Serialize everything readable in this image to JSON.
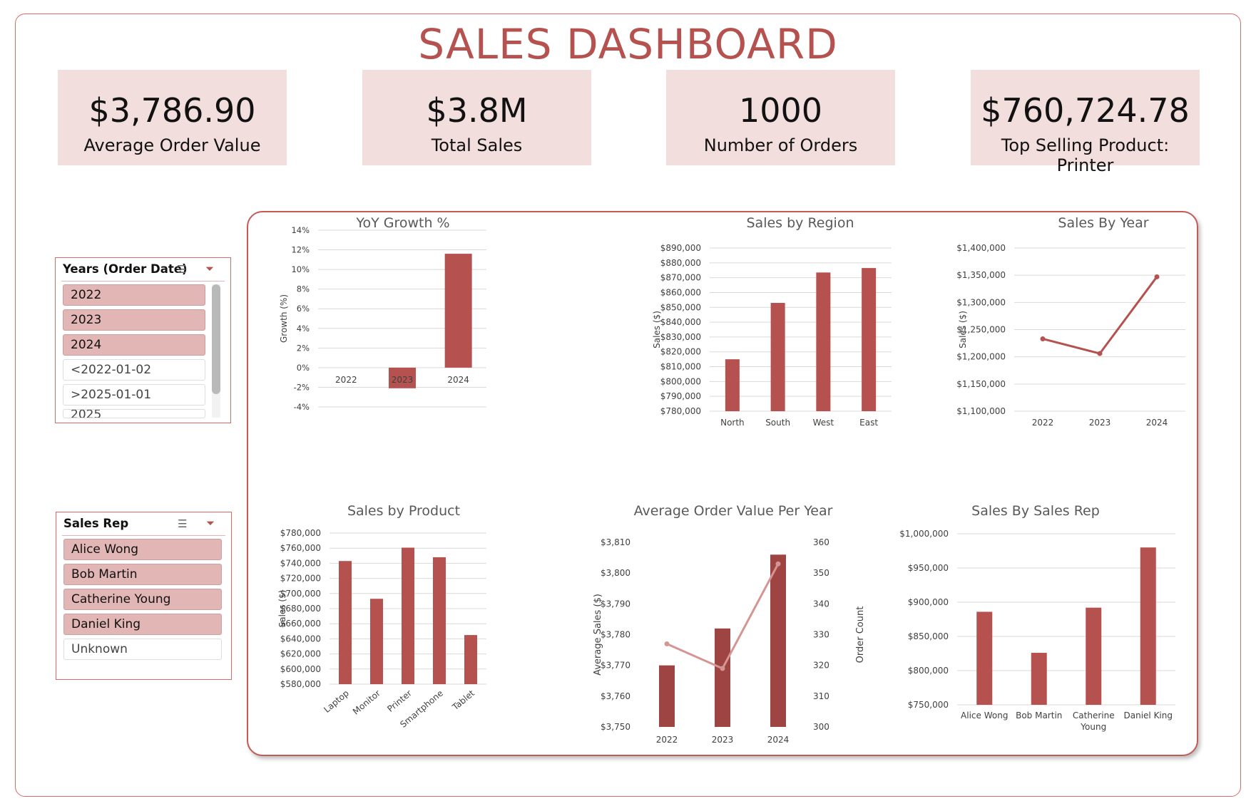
{
  "title": "SALES DASHBOARD",
  "kpis": [
    {
      "value": "$3,786.90",
      "label": "Average Order Value"
    },
    {
      "value": "$3.8M",
      "label": "Total Sales"
    },
    {
      "value": "1000",
      "label": "Number of Orders"
    },
    {
      "value": "$760,724.78",
      "label": "Top Selling Product: Printer"
    }
  ],
  "slicers": {
    "years": {
      "header": "Years (Order Date)",
      "items": [
        "2022",
        "2023",
        "2024",
        "<2022-01-02",
        ">2025-01-01",
        "2025"
      ],
      "selected": [
        true,
        true,
        true,
        false,
        false,
        false
      ]
    },
    "reps": {
      "header": "Sales Rep",
      "items": [
        "Alice Wong",
        "Bob Martin",
        "Catherine Young",
        "Daniel King",
        "Unknown"
      ],
      "selected": [
        true,
        true,
        true,
        true,
        false
      ]
    }
  },
  "icons": [
    "multi-select-icon",
    "clear-filter-icon"
  ],
  "colors": {
    "bar": "#b5524f",
    "bar_dark": "#9e4442",
    "line2": "#d59593",
    "accent": "#b5524f",
    "kpi_bg": "#f1dedd"
  },
  "chart_data": [
    {
      "type": "bar",
      "title": "YoY Growth %",
      "ylabel": "Growth (%)",
      "categories": [
        "2022",
        "2023",
        "2024"
      ],
      "values": [
        0,
        -2.1,
        11.6
      ],
      "ylim": [
        -4,
        14
      ],
      "yticks": [
        "14%",
        "12%",
        "10%",
        "8%",
        "6%",
        "4%",
        "2%",
        "0%",
        "-2%",
        "-4%"
      ]
    },
    {
      "type": "bar",
      "title": "Sales by Region",
      "ylabel": "Sales ($)",
      "categories": [
        "North",
        "South",
        "West",
        "East"
      ],
      "values": [
        815000,
        853000,
        873500,
        876500
      ],
      "ylim": [
        780000,
        890000
      ],
      "yticks": [
        "$890,000",
        "$880,000",
        "$870,000",
        "$860,000",
        "$850,000",
        "$840,000",
        "$830,000",
        "$820,000",
        "$810,000",
        "$800,000",
        "$790,000",
        "$780,000"
      ]
    },
    {
      "type": "line",
      "title": "Sales By Year",
      "ylabel": "Sales ($)",
      "categories": [
        "2022",
        "2023",
        "2024"
      ],
      "values": [
        1233000,
        1206000,
        1347000
      ],
      "ylim": [
        1100000,
        1400000
      ],
      "yticks": [
        "$1,400,000",
        "$1,350,000",
        "$1,300,000",
        "$1,250,000",
        "$1,200,000",
        "$1,150,000",
        "$1,100,000"
      ]
    },
    {
      "type": "bar",
      "title": "Sales by Product",
      "ylabel": "Sales ($)",
      "categories": [
        "Laptop",
        "Monitor",
        "Printer",
        "Smartphone",
        "Tablet"
      ],
      "values": [
        743000,
        693000,
        760700,
        748000,
        645000
      ],
      "ylim": [
        580000,
        780000
      ],
      "yticks": [
        "$780,000",
        "$760,000",
        "$740,000",
        "$720,000",
        "$700,000",
        "$680,000",
        "$660,000",
        "$640,000",
        "$620,000",
        "$600,000",
        "$580,000"
      ]
    },
    {
      "type": "bar",
      "title": "Average Order Value Per Year",
      "ylabel": "Average Sales ($)",
      "y2label": "Order Count",
      "categories": [
        "2022",
        "2023",
        "2024"
      ],
      "series": [
        {
          "values": [
            3770,
            3782,
            3806
          ]
        },
        {
          "values": [
            327,
            319,
            353
          ]
        }
      ],
      "ylim": [
        3750,
        3810
      ],
      "y2lim": [
        300,
        360
      ],
      "yticks": [
        "$3,810",
        "$3,800",
        "$3,790",
        "$3,780",
        "$3,770",
        "$3,760",
        "$3,750"
      ],
      "y2ticks": [
        "360",
        "350",
        "340",
        "330",
        "320",
        "310",
        "300"
      ]
    },
    {
      "type": "bar",
      "title": "Sales By Sales Rep",
      "categories": [
        "Alice Wong",
        "Bob Martin",
        "Catherine Young",
        "Daniel King"
      ],
      "values": [
        886000,
        826000,
        892000,
        980000
      ],
      "ylim": [
        750000,
        1000000
      ],
      "yticks": [
        "$1,000,000",
        "$950,000",
        "$900,000",
        "$850,000",
        "$800,000",
        "$750,000"
      ]
    }
  ]
}
